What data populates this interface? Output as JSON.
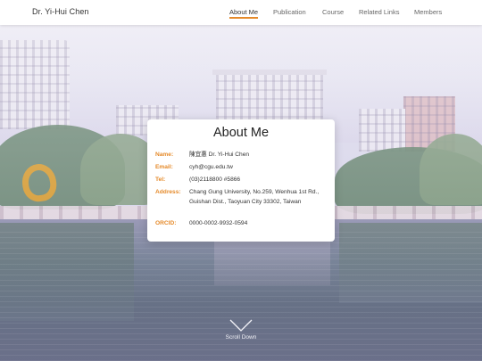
{
  "brand": "Dr. Yi-Hui Chen",
  "nav": {
    "items": [
      {
        "label": "About Me",
        "active": true
      },
      {
        "label": "Publication",
        "active": false
      },
      {
        "label": "Course",
        "active": false
      },
      {
        "label": "Related Links",
        "active": false
      },
      {
        "label": "Members",
        "active": false
      }
    ]
  },
  "about": {
    "title": "About Me",
    "name_label": "Name:",
    "name_value": "陳宜惠 Dr. Yi-Hui Chen",
    "email_label": "Email:",
    "email_value": "cyh@cgu.edu.tw",
    "tel_label": "Tel:",
    "tel_value": "(03)2118800 #5866",
    "address_label": "Address:",
    "address_value": "Chang Gung University, No.259, Wenhua 1st Rd., Guishan Dist., Taoyuan City 33302, Taiwan",
    "orcid_label": "ORCID:",
    "orcid_value": "0000-0002-9932-0594"
  },
  "scroll": {
    "label": "Scroll Down",
    "icon": "chevron-down-icon"
  },
  "colors": {
    "accent": "#e58a2a",
    "nav_bg": "#ffffff",
    "card_bg": "#ffffff"
  }
}
